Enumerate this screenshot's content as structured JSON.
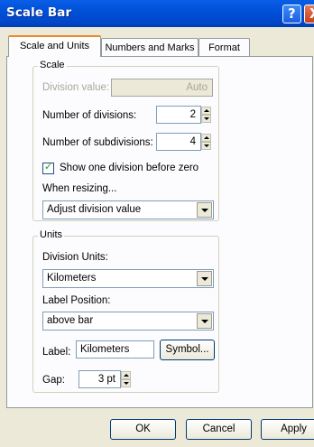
{
  "window": {
    "title": "Scale Bar"
  },
  "titlebar_buttons": {
    "help": "?",
    "close": "X"
  },
  "tabs": [
    {
      "label": "Scale and Units",
      "active": true
    },
    {
      "label": "Numbers and Marks",
      "active": false
    },
    {
      "label": "Format",
      "active": false
    }
  ],
  "scale_group": {
    "label": "Scale",
    "division_value": {
      "label": "Division value:",
      "value": "Auto"
    },
    "num_divisions": {
      "label": "Number of divisions:",
      "value": "2"
    },
    "num_subdivisions": {
      "label": "Number of subdivisions:",
      "value": "4"
    },
    "show_before_zero": {
      "label": "Show one division before zero",
      "checked": true
    },
    "when_resizing": {
      "label": "When resizing...",
      "value": "Adjust division value"
    }
  },
  "units_group": {
    "label": "Units",
    "division_units": {
      "label": "Division Units:",
      "value": "Kilometers"
    },
    "label_position": {
      "label": "Label Position:",
      "value": "above bar"
    },
    "label_field": {
      "label": "Label:",
      "value": "Kilometers"
    },
    "symbol_button": "Symbol...",
    "gap": {
      "label": "Gap:",
      "value": "3 pt"
    }
  },
  "footer": {
    "ok": "OK",
    "cancel": "Cancel",
    "apply": "Apply"
  }
}
